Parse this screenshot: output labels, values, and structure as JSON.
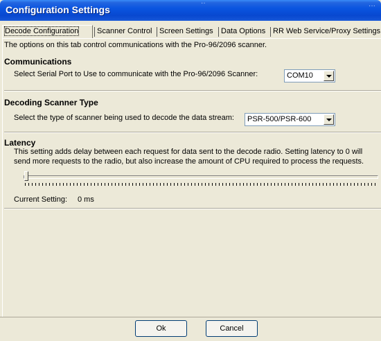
{
  "window": {
    "title": "Configuration Settings",
    "title_dots_1": "··",
    "title_dots_2": "···"
  },
  "tabs": [
    {
      "label": "Decode Configuration",
      "active": true
    },
    {
      "label": "Scanner Control"
    },
    {
      "label": "Screen Settings"
    },
    {
      "label": "Data Options"
    },
    {
      "label": "RR Web Service/Proxy Settings"
    }
  ],
  "intro": "The options on this tab control communications with the Pro-96/2096 scanner.",
  "communications": {
    "heading": "Communications",
    "label": "Select Serial Port to Use to communicate with the Pro-96/2096 Scanner:",
    "port": "COM10"
  },
  "decoding": {
    "heading": "Decoding Scanner Type",
    "label": "Select the type of scanner being used to decode the data stream:",
    "scanner_type": "PSR-500/PSR-600"
  },
  "latency": {
    "heading": "Latency",
    "desc_line1": "This setting adds delay between each request for data sent to the decode radio. Setting latency to 0 will",
    "desc_line2": "send more requests to the radio, but also increase the amount of CPU required to process the requests.",
    "slider_value": 0,
    "current_label": "Current Setting:",
    "current_value": "0 ms"
  },
  "buttons": {
    "ok": "Ok",
    "cancel": "Cancel"
  }
}
